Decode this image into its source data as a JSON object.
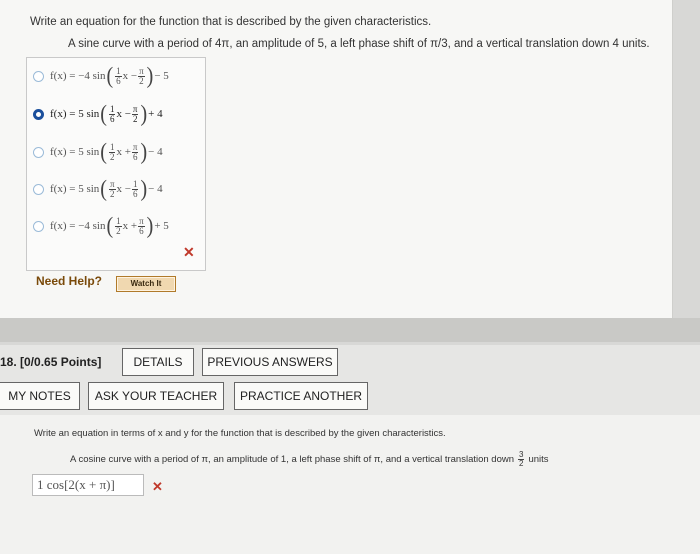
{
  "q1": {
    "prompt": "Write an equation for the function that is described by the given characteristics.",
    "description": "A sine curve with a period of 4π, an amplitude of 5, a left phase shift of π/3, and a vertical translation down 4 units.",
    "choices": [
      {
        "prefix": "f(x) = −4 sin",
        "f1n": "1",
        "f1d": "6",
        "mid": "x −",
        "f2n": "π",
        "f2d": "2",
        "suffix": "− 5",
        "selected": false
      },
      {
        "prefix": "f(x) = 5 sin",
        "f1n": "1",
        "f1d": "6",
        "mid": "x −",
        "f2n": "π",
        "f2d": "2",
        "suffix": "+ 4",
        "selected": true
      },
      {
        "prefix": "f(x) = 5 sin",
        "f1n": "1",
        "f1d": "2",
        "mid": "x +",
        "f2n": "π",
        "f2d": "6",
        "suffix": "− 4",
        "selected": false
      },
      {
        "prefix": "f(x) = 5 sin",
        "f1n": "π",
        "f1d": "2",
        "mid": "x −",
        "f2n": "1",
        "f2d": "6",
        "suffix": "− 4",
        "selected": false
      },
      {
        "prefix": "f(x) = −4 sin",
        "f1n": "1",
        "f1d": "2",
        "mid": "x +",
        "f2n": "π",
        "f2d": "6",
        "suffix": "+ 5",
        "selected": false
      }
    ],
    "incorrect_mark": "✕",
    "need_help": "Need Help?",
    "watch_button": "Watch It"
  },
  "q18": {
    "label": "18. [0/0.65 Points]",
    "details_button": "DETAILS",
    "previous_answers_button": "PREVIOUS ANSWERS",
    "my_notes_button": "MY NOTES",
    "ask_teacher_button": "ASK YOUR TEACHER",
    "practice_another_button": "PRACTICE ANOTHER",
    "prompt": "Write an equation in terms of x and y for the function that is described by the given characteristics.",
    "description": "A cosine curve with a period of π, an amplitude of 1, a left phase shift of π, and a vertical translation down",
    "frac_n": "3",
    "frac_d": "2",
    "units": "units",
    "answer_value": "1 cos[2(x + π)]",
    "incorrect_mark": "✕"
  },
  "colors": {
    "selected_radio": "#1b4f9c",
    "incorrect": "#c0392b",
    "watch_bg": "#f0d8b0"
  }
}
